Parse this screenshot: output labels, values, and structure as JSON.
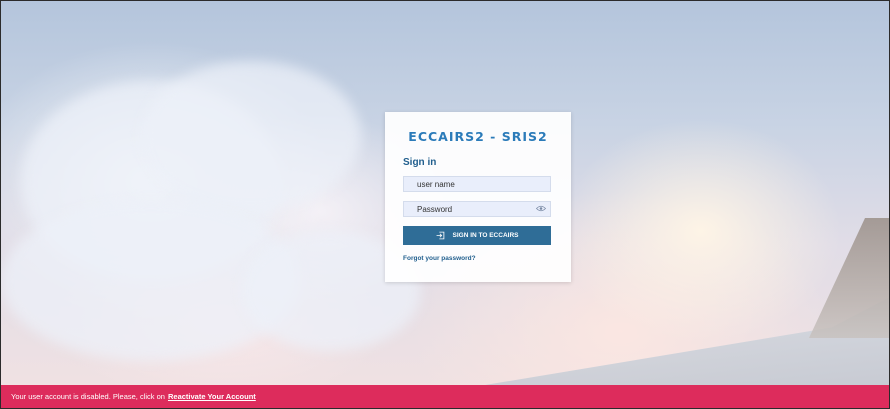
{
  "brand": {
    "logo_text": "ECCAIRS2 - SRIS2",
    "color": "#2b7bb9"
  },
  "login": {
    "heading": "Sign in",
    "username_placeholder": "user name",
    "password_placeholder": "Password",
    "password_toggle_icon": "eye-icon",
    "submit_icon": "login-icon",
    "submit_label": "SIGN IN TO ECCAIRS",
    "forgot_label": "Forgot your password?"
  },
  "alert": {
    "message": "Your user account is disabled. Please, click on",
    "link_label": "Reactivate Your Account",
    "color": "#dd2c5c"
  },
  "theme": {
    "primary": "#2f6d97",
    "heading": "#215f8e"
  }
}
